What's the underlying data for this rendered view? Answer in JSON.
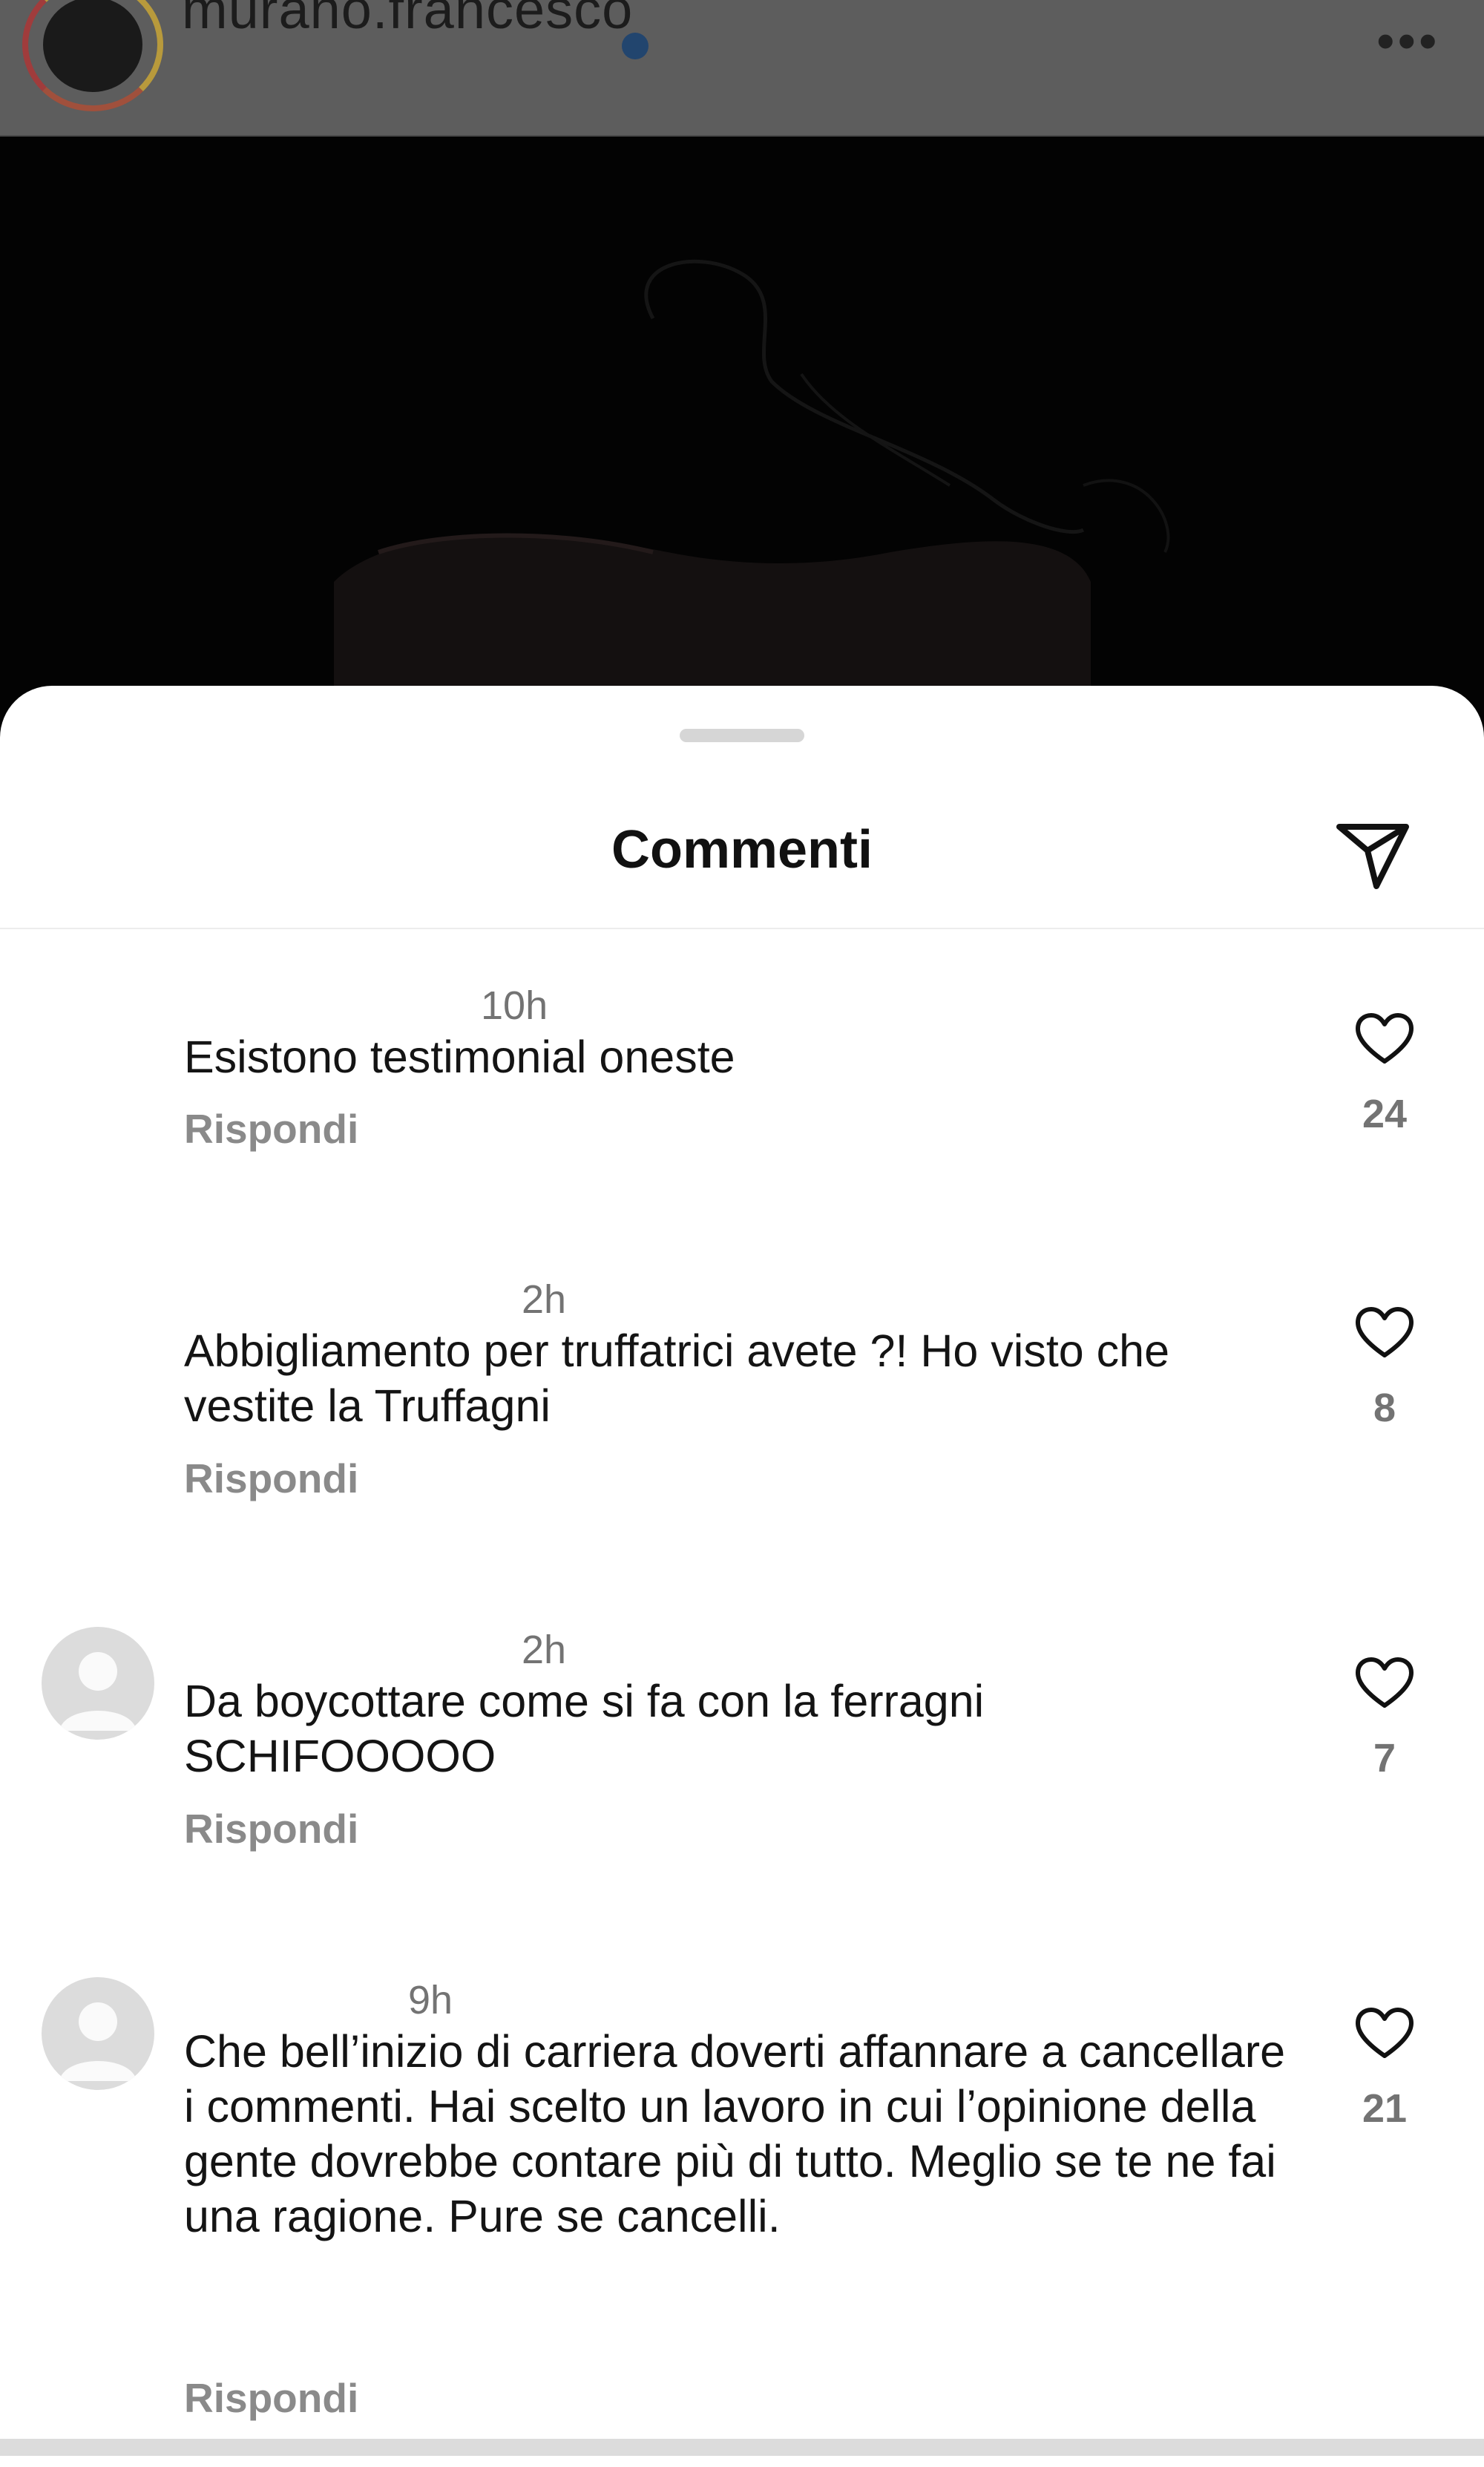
{
  "post": {
    "username": "murano.francesco"
  },
  "sheet": {
    "title": "Commenti"
  },
  "comments": [
    {
      "time": "10h",
      "text": "Esistono testimonial oneste",
      "reply_label": "Rispondi",
      "likes": "24"
    },
    {
      "time": "2h",
      "text": "Abbigliamento per truffatrici avete ?! Ho visto che vestite la Truffagni",
      "reply_label": "Rispondi",
      "likes": "8"
    },
    {
      "time": "2h",
      "text": "Da boycottare come si fa con la ferragni SCHIFOOOOO",
      "reply_label": "Rispondi",
      "likes": "7"
    },
    {
      "time": "9h",
      "text": "Che bell’inizio di carriera doverti affannare a cancellare i commenti. Hai scelto un lavoro in cui l’opinione della gente dovrebbe contare più di tutto. Meglio se te ne fai una ragione. Pure se cancelli.",
      "reply_label": "Rispondi",
      "likes": "21"
    }
  ],
  "icons": {
    "share": "paper-plane-icon",
    "like": "heart-icon",
    "more": "more-dots-icon",
    "verified": "verified-badge-icon"
  },
  "colors": {
    "sheet_background": "#ffffff",
    "dim_header": "#5d5d5d",
    "secondary_text": "#737373",
    "verified_blue": "#22456e"
  }
}
